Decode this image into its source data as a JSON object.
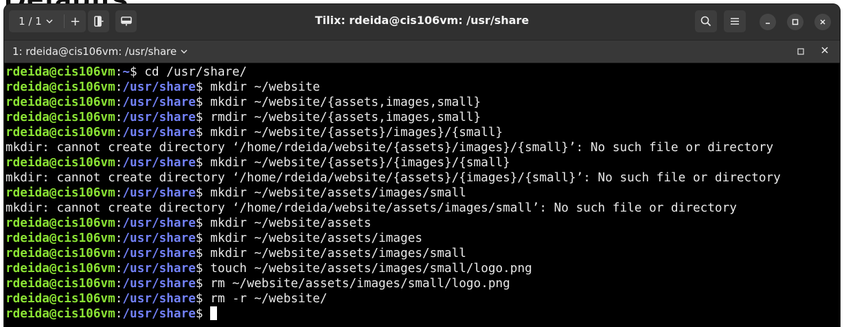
{
  "background": {
    "heading_fragment": "Defaults"
  },
  "window": {
    "title": "Tilix: rdeida@cis106vm: /usr/share",
    "session_label": "1 / 1",
    "add_session_label": "+"
  },
  "tab": {
    "title": "1: rdeida@cis106vm: /usr/share"
  },
  "icons": {
    "session_dropdown": "chevron-down-icon",
    "split_horizontal": "split-right-icon",
    "split_vertical": "split-down-icon",
    "search": "search-icon",
    "menu": "hamburger-menu-icon",
    "minimize": "minimize-icon",
    "maximize": "maximize-icon",
    "close": "close-icon"
  },
  "colors": {
    "prompt_user": "#8ae234",
    "prompt_path": "#7281f8",
    "terminal_text": "#e8e8e8",
    "terminal_bg": "#000000",
    "titlebar_bg": "#303030"
  },
  "terminal": {
    "lines": [
      {
        "user": "rdeida@cis106vm",
        "sep": ":",
        "path": "~",
        "sym": "$ ",
        "cmd": "cd /usr/share/"
      },
      {
        "user": "rdeida@cis106vm",
        "sep": ":",
        "path": "/usr/share",
        "sym": "$ ",
        "cmd": "mkdir ~/website"
      },
      {
        "user": "rdeida@cis106vm",
        "sep": ":",
        "path": "/usr/share",
        "sym": "$ ",
        "cmd": "mkdir ~/website/{assets,images,small}"
      },
      {
        "user": "rdeida@cis106vm",
        "sep": ":",
        "path": "/usr/share",
        "sym": "$ ",
        "cmd": "rmdir ~/website/{assets,images,small}"
      },
      {
        "user": "rdeida@cis106vm",
        "sep": ":",
        "path": "/usr/share",
        "sym": "$ ",
        "cmd": "mkdir ~/website/{assets}/images}/{small}"
      },
      {
        "output": "mkdir: cannot create directory ‘/home/rdeida/website/{assets}/images}/{small}’: No such file or directory"
      },
      {
        "user": "rdeida@cis106vm",
        "sep": ":",
        "path": "/usr/share",
        "sym": "$ ",
        "cmd": "mkdir ~/website/{assets}/{images}/{small}"
      },
      {
        "output": "mkdir: cannot create directory ‘/home/rdeida/website/{assets}/{images}/{small}’: No such file or directory"
      },
      {
        "user": "rdeida@cis106vm",
        "sep": ":",
        "path": "/usr/share",
        "sym": "$ ",
        "cmd": "mkdir ~/website/assets/images/small"
      },
      {
        "output": "mkdir: cannot create directory ‘/home/rdeida/website/assets/images/small’: No such file or directory"
      },
      {
        "user": "rdeida@cis106vm",
        "sep": ":",
        "path": "/usr/share",
        "sym": "$ ",
        "cmd": "mkdir ~/website/assets"
      },
      {
        "user": "rdeida@cis106vm",
        "sep": ":",
        "path": "/usr/share",
        "sym": "$ ",
        "cmd": "mkdir ~/website/assets/images"
      },
      {
        "user": "rdeida@cis106vm",
        "sep": ":",
        "path": "/usr/share",
        "sym": "$ ",
        "cmd": "mkdir ~/website/assets/images/small"
      },
      {
        "user": "rdeida@cis106vm",
        "sep": ":",
        "path": "/usr/share",
        "sym": "$ ",
        "cmd": "touch ~/website/assets/images/small/logo.png"
      },
      {
        "user": "rdeida@cis106vm",
        "sep": ":",
        "path": "/usr/share",
        "sym": "$ ",
        "cmd": "rm ~/website/assets/images/small/logo.png"
      },
      {
        "user": "rdeida@cis106vm",
        "sep": ":",
        "path": "/usr/share",
        "sym": "$ ",
        "cmd": "rm -r ~/website/"
      },
      {
        "user": "rdeida@cis106vm",
        "sep": ":",
        "path": "/usr/share",
        "sym": "$ ",
        "cmd": "",
        "cursor": true
      }
    ]
  }
}
